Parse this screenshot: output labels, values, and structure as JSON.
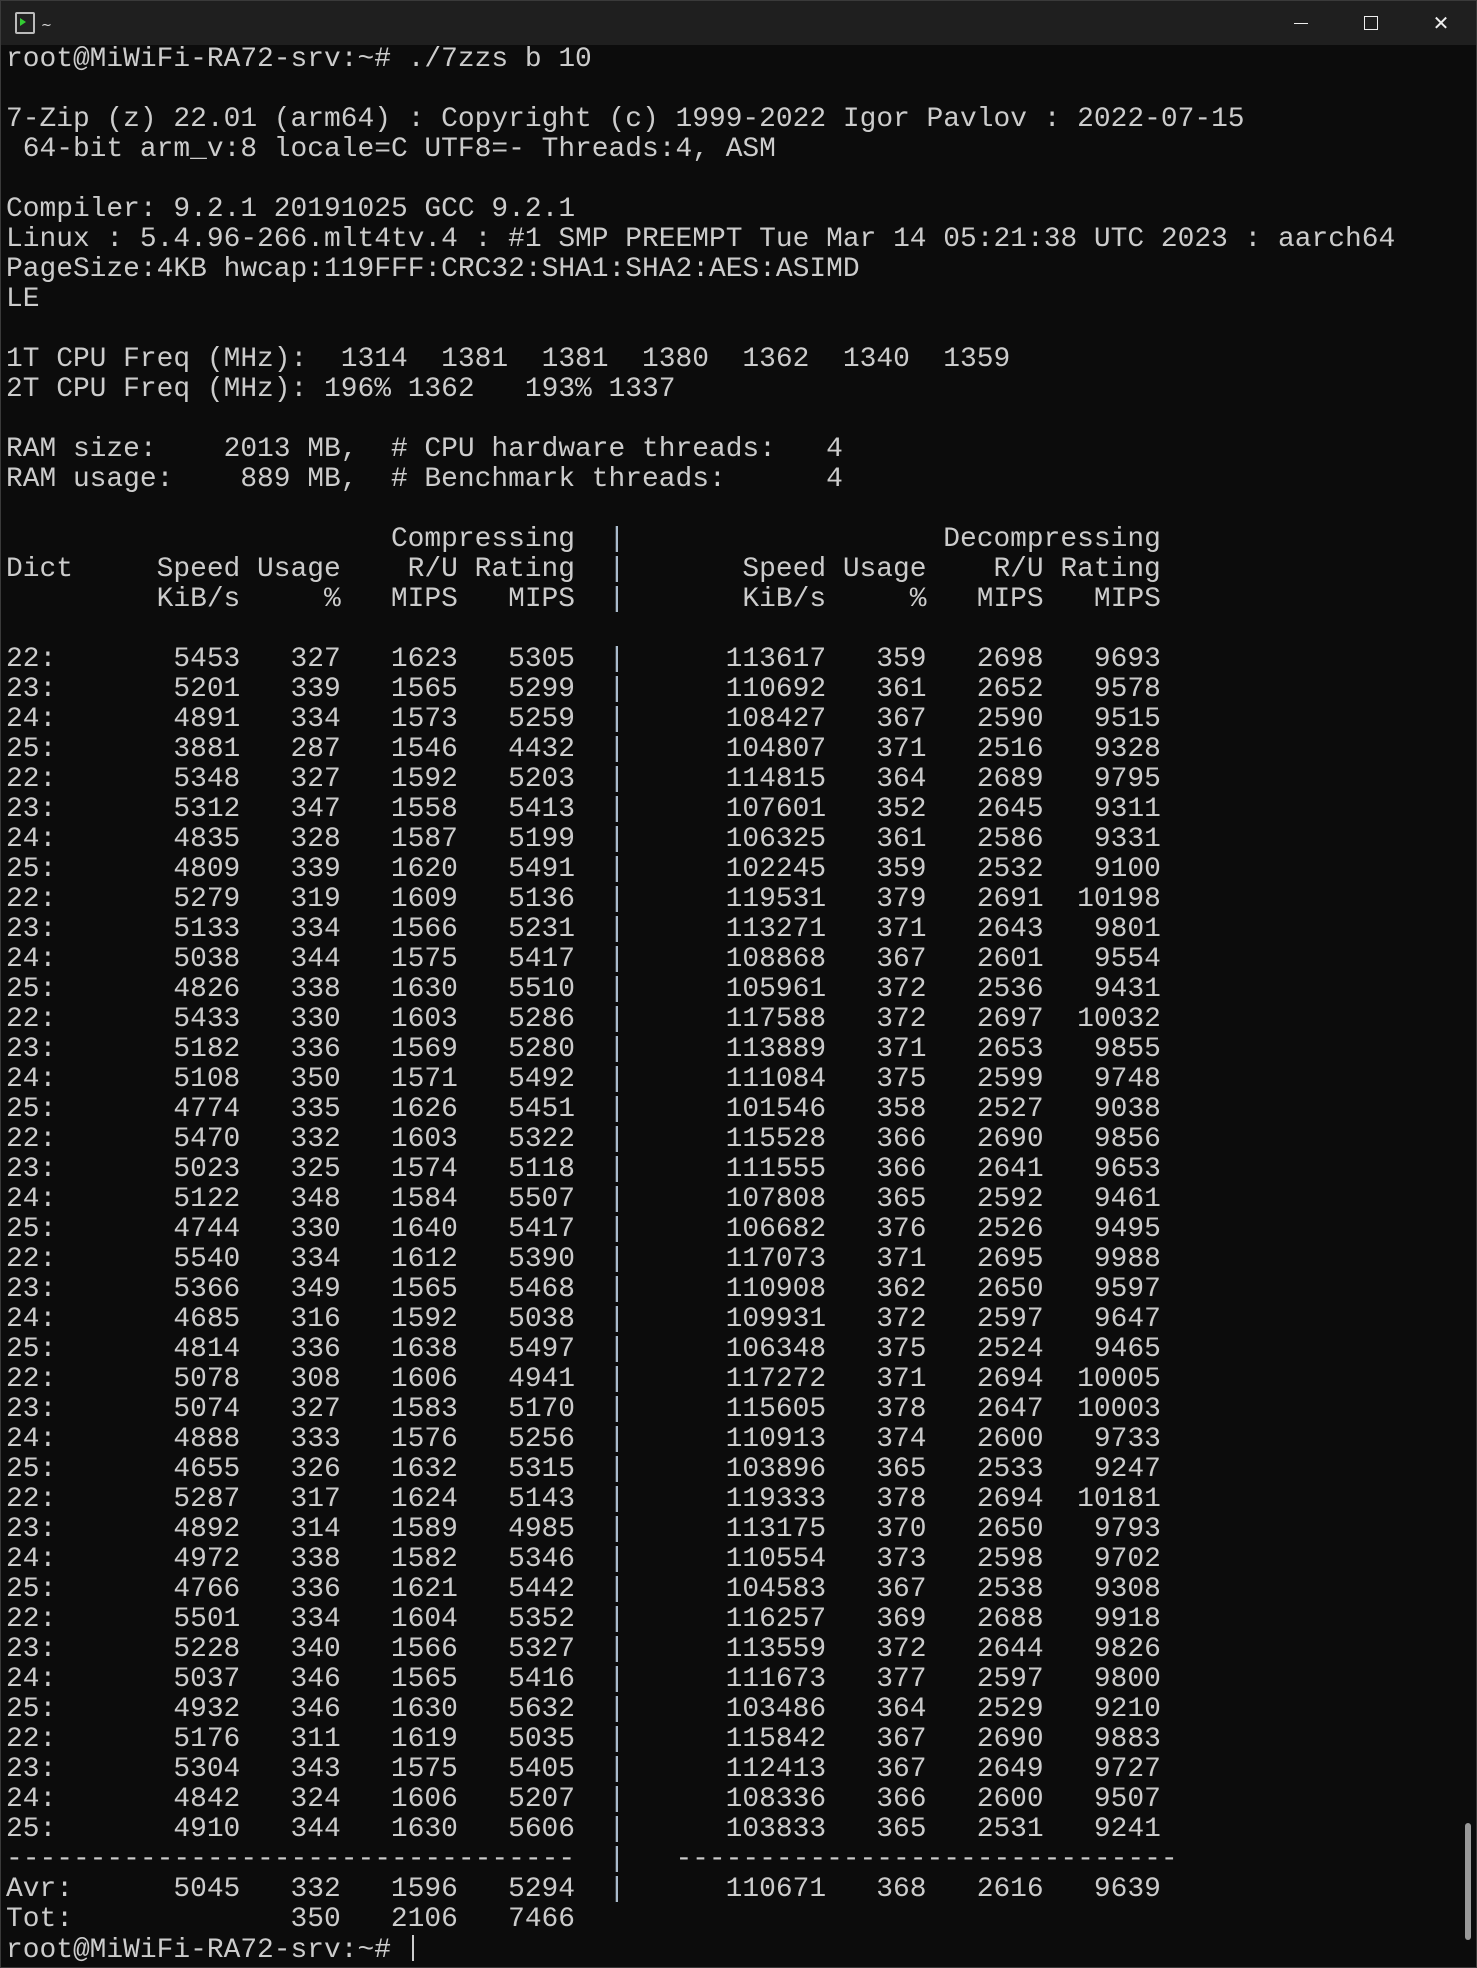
{
  "window": {
    "title": "~"
  },
  "pre_lines": [
    "root@MiWiFi-RA72-srv:~# ./7zzs b 10",
    "",
    "7-Zip (z) 22.01 (arm64) : Copyright (c) 1999-2022 Igor Pavlov : 2022-07-15",
    " 64-bit arm_v:8 locale=C UTF8=- Threads:4, ASM",
    "",
    "Compiler: 9.2.1 20191025 GCC 9.2.1",
    "Linux : 5.4.96-266.mlt4tv.4 : #1 SMP PREEMPT Tue Mar 14 05:21:38 UTC 2023 : aarch64",
    "PageSize:4KB hwcap:119FFF:CRC32:SHA1:SHA2:AES:ASIMD",
    "LE",
    "",
    "1T CPU Freq (MHz):  1314  1381  1381  1380  1362  1340  1359",
    "2T CPU Freq (MHz): 196% 1362   193% 1337",
    "",
    "RAM size:    2013 MB,  # CPU hardware threads:   4",
    "RAM usage:    889 MB,  # Benchmark threads:      4",
    ""
  ],
  "table": {
    "group_compress": "Compressing",
    "group_decompress": "Decompressing",
    "header1": [
      "Dict",
      "Speed",
      "Usage",
      "R/U",
      "Rating",
      "Speed",
      "Usage",
      "R/U",
      "Rating"
    ],
    "header2": [
      "",
      "KiB/s",
      "%",
      "MIPS",
      "MIPS",
      "KiB/s",
      "%",
      "MIPS",
      "MIPS"
    ],
    "rows": [
      [
        "22:",
        "5453",
        "327",
        "1623",
        "5305",
        "113617",
        "359",
        "2698",
        "9693"
      ],
      [
        "23:",
        "5201",
        "339",
        "1565",
        "5299",
        "110692",
        "361",
        "2652",
        "9578"
      ],
      [
        "24:",
        "4891",
        "334",
        "1573",
        "5259",
        "108427",
        "367",
        "2590",
        "9515"
      ],
      [
        "25:",
        "3881",
        "287",
        "1546",
        "4432",
        "104807",
        "371",
        "2516",
        "9328"
      ],
      [
        "22:",
        "5348",
        "327",
        "1592",
        "5203",
        "114815",
        "364",
        "2689",
        "9795"
      ],
      [
        "23:",
        "5312",
        "347",
        "1558",
        "5413",
        "107601",
        "352",
        "2645",
        "9311"
      ],
      [
        "24:",
        "4835",
        "328",
        "1587",
        "5199",
        "106325",
        "361",
        "2586",
        "9331"
      ],
      [
        "25:",
        "4809",
        "339",
        "1620",
        "5491",
        "102245",
        "359",
        "2532",
        "9100"
      ],
      [
        "22:",
        "5279",
        "319",
        "1609",
        "5136",
        "119531",
        "379",
        "2691",
        "10198"
      ],
      [
        "23:",
        "5133",
        "334",
        "1566",
        "5231",
        "113271",
        "371",
        "2643",
        "9801"
      ],
      [
        "24:",
        "5038",
        "344",
        "1575",
        "5417",
        "108868",
        "367",
        "2601",
        "9554"
      ],
      [
        "25:",
        "4826",
        "338",
        "1630",
        "5510",
        "105961",
        "372",
        "2536",
        "9431"
      ],
      [
        "22:",
        "5433",
        "330",
        "1603",
        "5286",
        "117588",
        "372",
        "2697",
        "10032"
      ],
      [
        "23:",
        "5182",
        "336",
        "1569",
        "5280",
        "113889",
        "371",
        "2653",
        "9855"
      ],
      [
        "24:",
        "5108",
        "350",
        "1571",
        "5492",
        "111084",
        "375",
        "2599",
        "9748"
      ],
      [
        "25:",
        "4774",
        "335",
        "1626",
        "5451",
        "101546",
        "358",
        "2527",
        "9038"
      ],
      [
        "22:",
        "5470",
        "332",
        "1603",
        "5322",
        "115528",
        "366",
        "2690",
        "9856"
      ],
      [
        "23:",
        "5023",
        "325",
        "1574",
        "5118",
        "111555",
        "366",
        "2641",
        "9653"
      ],
      [
        "24:",
        "5122",
        "348",
        "1584",
        "5507",
        "107808",
        "365",
        "2592",
        "9461"
      ],
      [
        "25:",
        "4744",
        "330",
        "1640",
        "5417",
        "106682",
        "376",
        "2526",
        "9495"
      ],
      [
        "22:",
        "5540",
        "334",
        "1612",
        "5390",
        "117073",
        "371",
        "2695",
        "9988"
      ],
      [
        "23:",
        "5366",
        "349",
        "1565",
        "5468",
        "110908",
        "362",
        "2650",
        "9597"
      ],
      [
        "24:",
        "4685",
        "316",
        "1592",
        "5038",
        "109931",
        "372",
        "2597",
        "9647"
      ],
      [
        "25:",
        "4814",
        "336",
        "1638",
        "5497",
        "106348",
        "375",
        "2524",
        "9465"
      ],
      [
        "22:",
        "5078",
        "308",
        "1606",
        "4941",
        "117272",
        "371",
        "2694",
        "10005"
      ],
      [
        "23:",
        "5074",
        "327",
        "1583",
        "5170",
        "115605",
        "378",
        "2647",
        "10003"
      ],
      [
        "24:",
        "4888",
        "333",
        "1576",
        "5256",
        "110913",
        "374",
        "2600",
        "9733"
      ],
      [
        "25:",
        "4655",
        "326",
        "1632",
        "5315",
        "103896",
        "365",
        "2533",
        "9247"
      ],
      [
        "22:",
        "5287",
        "317",
        "1624",
        "5143",
        "119333",
        "378",
        "2694",
        "10181"
      ],
      [
        "23:",
        "4892",
        "314",
        "1589",
        "4985",
        "113175",
        "370",
        "2650",
        "9793"
      ],
      [
        "24:",
        "4972",
        "338",
        "1582",
        "5346",
        "110554",
        "373",
        "2598",
        "9702"
      ],
      [
        "25:",
        "4766",
        "336",
        "1621",
        "5442",
        "104583",
        "367",
        "2538",
        "9308"
      ],
      [
        "22:",
        "5501",
        "334",
        "1604",
        "5352",
        "116257",
        "369",
        "2688",
        "9918"
      ],
      [
        "23:",
        "5228",
        "340",
        "1566",
        "5327",
        "113559",
        "372",
        "2644",
        "9826"
      ],
      [
        "24:",
        "5037",
        "346",
        "1565",
        "5416",
        "111673",
        "377",
        "2597",
        "9800"
      ],
      [
        "25:",
        "4932",
        "346",
        "1630",
        "5632",
        "103486",
        "364",
        "2529",
        "9210"
      ],
      [
        "22:",
        "5176",
        "311",
        "1619",
        "5035",
        "115842",
        "367",
        "2690",
        "9883"
      ],
      [
        "23:",
        "5304",
        "343",
        "1575",
        "5405",
        "112413",
        "367",
        "2649",
        "9727"
      ],
      [
        "24:",
        "4842",
        "324",
        "1606",
        "5207",
        "108336",
        "366",
        "2600",
        "9507"
      ],
      [
        "25:",
        "4910",
        "344",
        "1630",
        "5606",
        "103833",
        "365",
        "2531",
        "9241"
      ]
    ],
    "separator_left": "----------------------------------",
    "separator_right": "------------------------------",
    "avr": [
      "Avr:",
      "5045",
      "332",
      "1596",
      "5294",
      "110671",
      "368",
      "2616",
      "9639"
    ],
    "tot": [
      "Tot:",
      "",
      "350",
      "2106",
      "7466"
    ]
  },
  "prompt": "root@MiWiFi-RA72-srv:~# "
}
